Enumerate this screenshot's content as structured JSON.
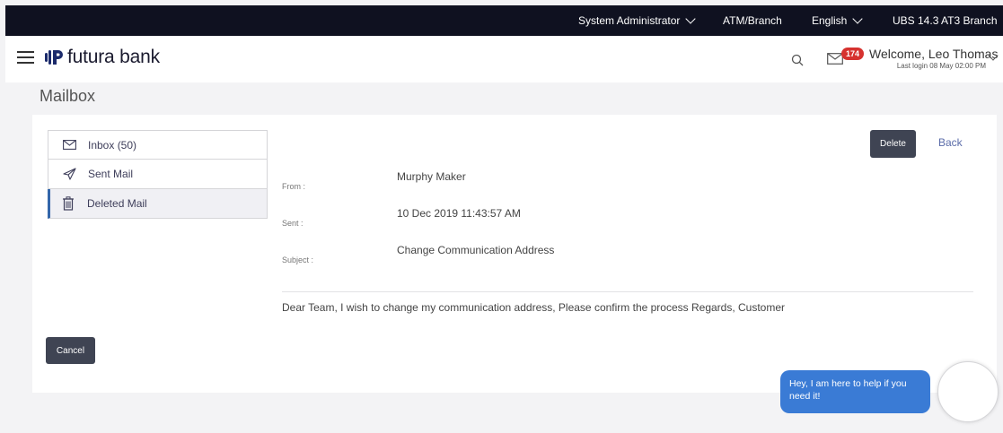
{
  "topbar": {
    "role": "System Administrator",
    "entity": "ATM/Branch",
    "language": "English",
    "branch": "UBS 14.3 AT3 Branch"
  },
  "header": {
    "brand": "futura bank",
    "notification_count": "174",
    "welcome": "Welcome, Leo Thomas",
    "last_login": "Last login 08 May 02:00 PM"
  },
  "page": {
    "title": "Mailbox"
  },
  "sidebar": {
    "items": [
      {
        "label": "Inbox (50)",
        "icon": "envelope-icon",
        "active": false
      },
      {
        "label": "Sent Mail",
        "icon": "paper-plane-icon",
        "active": false
      },
      {
        "label": "Deleted Mail",
        "icon": "trash-icon",
        "active": true
      }
    ]
  },
  "actions": {
    "delete_label": "Delete",
    "back_label": "Back",
    "cancel_label": "Cancel"
  },
  "message": {
    "from_label": "From :",
    "from": "Murphy Maker",
    "sent_label": "Sent :",
    "sent": "10 Dec 2019 11:43:57 AM",
    "subject_label": "Subject :",
    "subject": "Change Communication Address",
    "body": "Dear Team, I wish to change my communication address, Please confirm the process Regards, Customer"
  },
  "chat": {
    "prompt": "Hey, I am here to help if you need it!"
  },
  "colors": {
    "topbar": "#0f1120",
    "badge": "#d6322f",
    "chat": "#3a7bd5",
    "button": "#3f4453",
    "link": "#5b6ca9"
  }
}
